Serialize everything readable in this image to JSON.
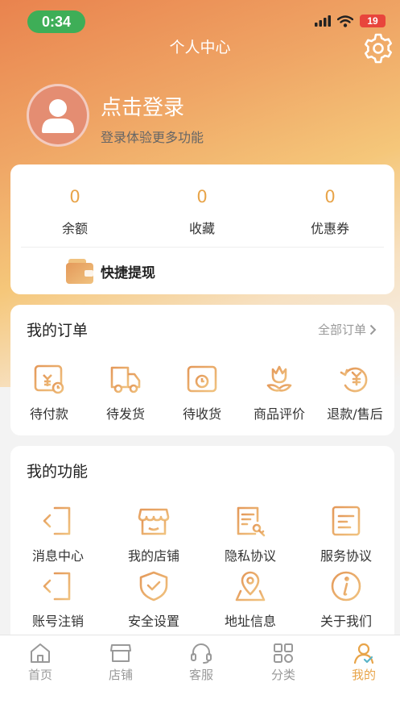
{
  "status_bar": {
    "time": "0:34",
    "battery": "19"
  },
  "header": {
    "title": "个人中心",
    "settings_icon": "gear-icon"
  },
  "profile": {
    "login_title": "点击登录",
    "login_subtitle": "登录体验更多功能"
  },
  "assets": {
    "items": [
      {
        "value": "0",
        "label": "余额"
      },
      {
        "value": "0",
        "label": "收藏"
      },
      {
        "value": "0",
        "label": "优惠券"
      }
    ],
    "quick_withdraw": "快捷提现"
  },
  "orders": {
    "title": "我的订单",
    "all_label": "全部订单",
    "items": [
      {
        "label": "待付款",
        "icon": "pending-payment-icon"
      },
      {
        "label": "待发货",
        "icon": "truck-icon"
      },
      {
        "label": "待收货",
        "icon": "clock-box-icon"
      },
      {
        "label": "商品评价",
        "icon": "tulip-icon"
      },
      {
        "label": "退款/售后",
        "icon": "refund-icon"
      }
    ]
  },
  "functions": {
    "title": "我的功能",
    "items": [
      {
        "label": "消息中心",
        "icon": "exit-icon"
      },
      {
        "label": "我的店铺",
        "icon": "store-icon"
      },
      {
        "label": "隐私协议",
        "icon": "document-key-icon"
      },
      {
        "label": "服务协议",
        "icon": "document-icon"
      },
      {
        "label": "账号注销",
        "icon": "exit-icon"
      },
      {
        "label": "安全设置",
        "icon": "shield-check-icon"
      },
      {
        "label": "地址信息",
        "icon": "location-pin-icon"
      },
      {
        "label": "关于我们",
        "icon": "info-icon"
      }
    ]
  },
  "tabbar": {
    "items": [
      {
        "label": "首页",
        "icon": "home-icon"
      },
      {
        "label": "店铺",
        "icon": "shop-icon"
      },
      {
        "label": "客服",
        "icon": "headset-icon"
      },
      {
        "label": "分类",
        "icon": "category-icon"
      },
      {
        "label": "我的",
        "icon": "person-icon"
      }
    ],
    "active_index": 4
  },
  "colors": {
    "accent": "#e8a449",
    "hero_start": "#e9834e",
    "hero_end": "#f5c77a",
    "active_tab": "#e8a449"
  }
}
